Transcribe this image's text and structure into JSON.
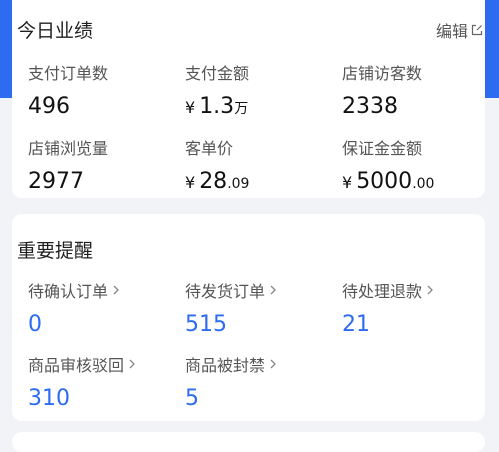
{
  "today": {
    "title": "今日业绩",
    "edit_label": "编辑",
    "metrics": [
      {
        "label": "支付订单数",
        "value": "496"
      },
      {
        "label": "支付金额",
        "currency": "¥",
        "value": "1.3",
        "unit": "万"
      },
      {
        "label": "店铺访客数",
        "value": "2338"
      },
      {
        "label": "店铺浏览量",
        "value": "2977"
      },
      {
        "label": "客单价",
        "currency": "¥",
        "value": "28",
        "decimals": ".09"
      },
      {
        "label": "保证金金额",
        "currency": "¥",
        "value": "5000",
        "decimals": ".00"
      }
    ]
  },
  "alerts": {
    "title": "重要提醒",
    "items": [
      {
        "label": "待确认订单",
        "value": "0"
      },
      {
        "label": "待发货订单",
        "value": "515"
      },
      {
        "label": "待处理退款",
        "value": "21"
      },
      {
        "label": "商品审核驳回",
        "value": "310"
      },
      {
        "label": "商品被封禁",
        "value": "5"
      }
    ]
  },
  "colors": {
    "accent": "#2d6cf0"
  },
  "icons": {
    "edit": "edit-square-icon",
    "chevron": "chevron-right-icon"
  }
}
